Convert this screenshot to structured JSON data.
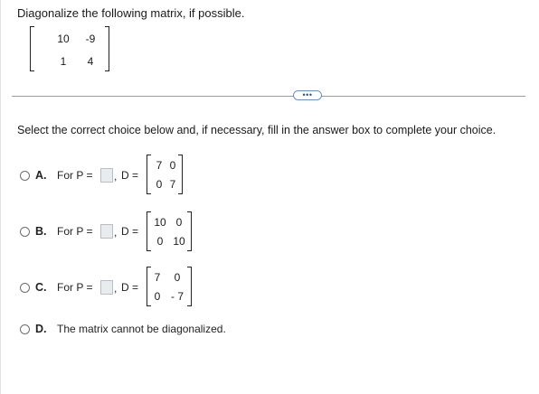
{
  "question": {
    "text": "Diagonalize the following matrix, if possible.",
    "matrix": {
      "r1c1": "10",
      "r1c2": "-9",
      "r2c1": "1",
      "r2c2": "4"
    }
  },
  "divider": {
    "button_label": "•••"
  },
  "instruction": "Select the correct choice below and, if necessary, fill in the answer box to complete your choice.",
  "options": {
    "A": {
      "letter": "A.",
      "p_label": "For P =",
      "sep": ",",
      "d_label": "D =",
      "d_matrix": {
        "r1c1": "7",
        "r1c2": "0",
        "r2c1": "0",
        "r2c2": "7"
      }
    },
    "B": {
      "letter": "B.",
      "p_label": "For P =",
      "sep": ",",
      "d_label": "D =",
      "d_matrix": {
        "r1c1": "10",
        "r1c2": "0",
        "r2c1": "0",
        "r2c2": "10"
      }
    },
    "C": {
      "letter": "C.",
      "p_label": "For P =",
      "sep": ",",
      "d_label": "D =",
      "d_matrix": {
        "r1c1": "7",
        "r1c2": "0",
        "r2c1": "0",
        "r2c2": "- 7"
      }
    },
    "D": {
      "letter": "D.",
      "text": "The matrix cannot be diagonalized."
    }
  }
}
